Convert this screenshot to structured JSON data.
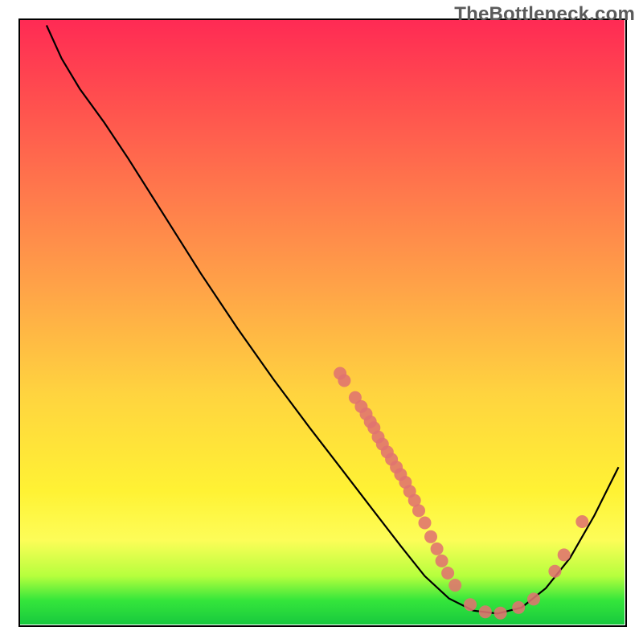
{
  "watermark": "TheBottleneck.com",
  "chart_data": {
    "type": "line",
    "title": "",
    "xlabel": "",
    "ylabel": "",
    "xlim": [
      0,
      100
    ],
    "ylim": [
      0,
      100
    ],
    "curve": [
      {
        "x": 4.5,
        "y": 99.0
      },
      {
        "x": 7.0,
        "y": 93.5
      },
      {
        "x": 10.0,
        "y": 88.5
      },
      {
        "x": 14.0,
        "y": 83.0
      },
      {
        "x": 18.0,
        "y": 77.0
      },
      {
        "x": 24.0,
        "y": 67.5
      },
      {
        "x": 30.0,
        "y": 58.0
      },
      {
        "x": 36.0,
        "y": 49.0
      },
      {
        "x": 42.0,
        "y": 40.5
      },
      {
        "x": 48.0,
        "y": 32.5
      },
      {
        "x": 53.0,
        "y": 26.0
      },
      {
        "x": 58.0,
        "y": 19.5
      },
      {
        "x": 63.0,
        "y": 13.0
      },
      {
        "x": 67.0,
        "y": 8.0
      },
      {
        "x": 71.0,
        "y": 4.3
      },
      {
        "x": 75.0,
        "y": 2.3
      },
      {
        "x": 79.0,
        "y": 1.8
      },
      {
        "x": 83.0,
        "y": 2.8
      },
      {
        "x": 87.0,
        "y": 6.0
      },
      {
        "x": 91.0,
        "y": 11.0
      },
      {
        "x": 95.0,
        "y": 18.0
      },
      {
        "x": 99.0,
        "y": 26.0
      }
    ],
    "markers": [
      {
        "x": 53.0,
        "y": 41.5
      },
      {
        "x": 53.7,
        "y": 40.3
      },
      {
        "x": 55.5,
        "y": 37.5
      },
      {
        "x": 56.5,
        "y": 36.0
      },
      {
        "x": 57.3,
        "y": 34.8
      },
      {
        "x": 58.0,
        "y": 33.5
      },
      {
        "x": 58.6,
        "y": 32.5
      },
      {
        "x": 59.3,
        "y": 31.0
      },
      {
        "x": 60.0,
        "y": 29.8
      },
      {
        "x": 60.8,
        "y": 28.5
      },
      {
        "x": 61.5,
        "y": 27.3
      },
      {
        "x": 62.3,
        "y": 26.0
      },
      {
        "x": 63.0,
        "y": 24.8
      },
      {
        "x": 63.8,
        "y": 23.5
      },
      {
        "x": 64.5,
        "y": 22.0
      },
      {
        "x": 65.3,
        "y": 20.5
      },
      {
        "x": 66.0,
        "y": 18.8
      },
      {
        "x": 67.0,
        "y": 16.8
      },
      {
        "x": 68.0,
        "y": 14.5
      },
      {
        "x": 69.0,
        "y": 12.5
      },
      {
        "x": 69.8,
        "y": 10.5
      },
      {
        "x": 70.8,
        "y": 8.5
      },
      {
        "x": 72.0,
        "y": 6.5
      },
      {
        "x": 74.5,
        "y": 3.3
      },
      {
        "x": 77.0,
        "y": 2.1
      },
      {
        "x": 79.5,
        "y": 1.9
      },
      {
        "x": 82.5,
        "y": 2.8
      },
      {
        "x": 85.0,
        "y": 4.2
      },
      {
        "x": 88.5,
        "y": 8.8
      },
      {
        "x": 90.0,
        "y": 11.5
      },
      {
        "x": 93.0,
        "y": 17.0
      }
    ],
    "marker_color": "#e0736f",
    "marker_radius": 8
  }
}
